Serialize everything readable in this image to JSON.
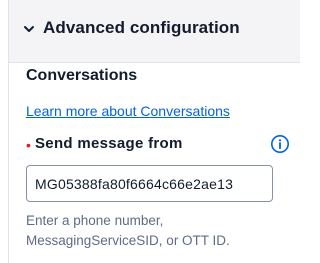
{
  "header": {
    "title": "Advanced configuration",
    "icon": "chevron-down-icon"
  },
  "section": {
    "title": "Conversations",
    "link_text": "Learn more about Conversations"
  },
  "field": {
    "required_marker": "•",
    "label": "Send message from",
    "info_icon": "info-icon",
    "value": "MG05388fa80f6664c66e2ae13",
    "help_line_1": "Enter a phone number,",
    "help_line_2": "MessagingServiceSID, or OTT ID."
  },
  "colors": {
    "link": "#0263e0",
    "required": "#d61f1f",
    "text": "#121c2d",
    "help": "#606b85",
    "header_bg": "#f4f4f6"
  }
}
